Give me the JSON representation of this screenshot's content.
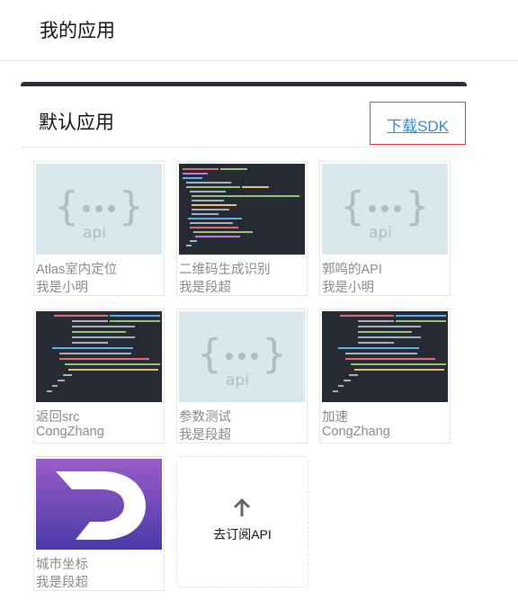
{
  "page": {
    "title": "我的应用"
  },
  "section": {
    "title": "默认应用",
    "sdk_link": "下载SDK"
  },
  "apps": [
    {
      "name": "Atlas室内定位",
      "owner": "我是小明",
      "thumbnail": "api-icon"
    },
    {
      "name": "二维码生成识别",
      "owner": "我是段超",
      "thumbnail": "code-screenshot"
    },
    {
      "name": "郭鸣的API",
      "owner": "我是小明",
      "thumbnail": "api-icon"
    },
    {
      "name": "返回src",
      "owner": "CongZhang",
      "thumbnail": "code-screenshot"
    },
    {
      "name": "参数测试",
      "owner": "我是段超",
      "thumbnail": "api-icon"
    },
    {
      "name": "加速",
      "owner": "CongZhang",
      "thumbnail": "code-screenshot"
    },
    {
      "name": "城市坐标",
      "owner": "我是段超",
      "thumbnail": "letter-d-logo"
    }
  ],
  "add_card": {
    "label": "去订阅API",
    "icon": "arrow-up-icon"
  },
  "colors": {
    "accent_link": "#2f8dd6",
    "highlight_border": "#e0383b",
    "code_bg": "#262a33",
    "api_bg": "#d8e8ec",
    "logo_purple": "#7b4fc4"
  }
}
